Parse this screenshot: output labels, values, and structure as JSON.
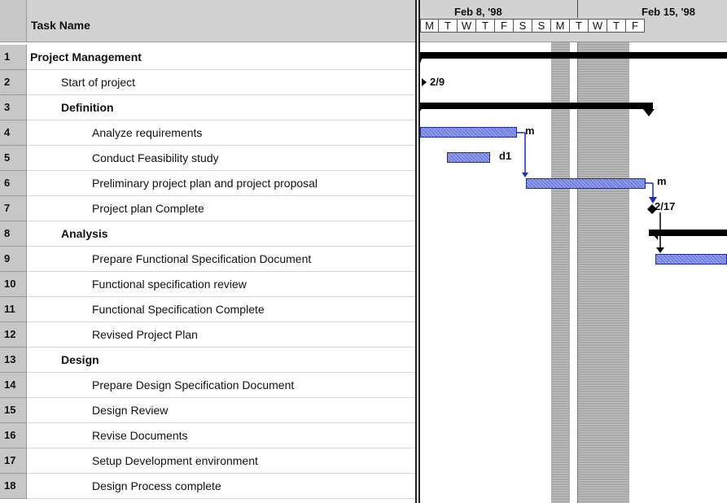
{
  "table": {
    "header": "Task Name",
    "rows": [
      {
        "id": "1",
        "name": "Project Management",
        "level": 0
      },
      {
        "id": "2",
        "name": "Start of project",
        "level": 1
      },
      {
        "id": "3",
        "name": "Definition",
        "level": 1,
        "bold": true
      },
      {
        "id": "4",
        "name": "Analyze requirements",
        "level": 2
      },
      {
        "id": "5",
        "name": "Conduct Feasibility study",
        "level": 2
      },
      {
        "id": "6",
        "name": "Preliminary project plan and project proposal",
        "level": 2
      },
      {
        "id": "7",
        "name": "Project plan Complete",
        "level": 2
      },
      {
        "id": "8",
        "name": "Analysis",
        "level": 1,
        "bold": true
      },
      {
        "id": "9",
        "name": "Prepare Functional Specification Document",
        "level": 2
      },
      {
        "id": "10",
        "name": "Functional specification review",
        "level": 2
      },
      {
        "id": "11",
        "name": "Functional Specification Complete",
        "level": 2
      },
      {
        "id": "12",
        "name": "Revised Project Plan",
        "level": 2
      },
      {
        "id": "13",
        "name": "Design",
        "level": 1,
        "bold": true
      },
      {
        "id": "14",
        "name": "Prepare Design Specification Document",
        "level": 2
      },
      {
        "id": "15",
        "name": "Design Review",
        "level": 2
      },
      {
        "id": "16",
        "name": "Revise Documents",
        "level": 2
      },
      {
        "id": "17",
        "name": "Setup Development environment",
        "level": 2
      },
      {
        "id": "18",
        "name": "Design Process complete",
        "level": 2
      }
    ]
  },
  "timescale": {
    "weeks": [
      "Feb 8, '98",
      "Feb 15, '98"
    ],
    "days": [
      "M",
      "T",
      "W",
      "T",
      "F",
      "S",
      "S",
      "M",
      "T",
      "W",
      "T",
      "F"
    ]
  },
  "gantt": {
    "labels": {
      "start": "2/9",
      "analyze": "m",
      "feasibility": "d1",
      "preliminary": "m",
      "milestone": "2/17"
    }
  },
  "colors": {
    "task_bar": "#6f7fe0",
    "nonworking": "#a9a9a9",
    "summary": "#000000"
  }
}
